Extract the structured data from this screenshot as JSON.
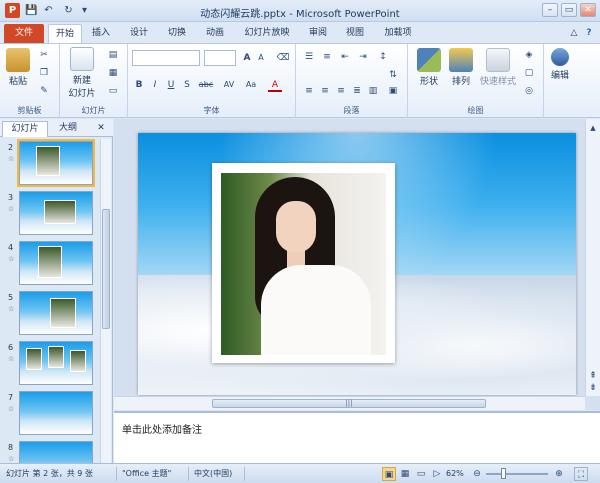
{
  "window": {
    "title": "动态闪耀云跳.pptx - Microsoft PowerPoint",
    "app_letter": "P",
    "qa_save": "💾",
    "qa_undo": "↶",
    "qa_redo": "↻",
    "qa_more": "▾",
    "btn_minimize": "–",
    "btn_restore": "▭",
    "btn_close": "✕"
  },
  "tabs": {
    "file": "文件",
    "home": "开始",
    "insert": "插入",
    "design": "设计",
    "transitions": "切换",
    "animations": "动画",
    "slideshow": "幻灯片放映",
    "review": "审阅",
    "view": "视图",
    "addins": "加载项",
    "collapse": "△",
    "help": "?"
  },
  "ribbon": {
    "clipboard": {
      "paste": "粘贴",
      "label": "剪贴板"
    },
    "slides": {
      "new_slide_line1": "新建",
      "new_slide_line2": "幻灯片",
      "label": "幻灯片"
    },
    "font": {
      "label": "字体",
      "bold": "B",
      "italic": "I",
      "underline": "U",
      "strike": "S",
      "shadow": "abc",
      "spacing": "AV",
      "case": "Aa",
      "grow": "A",
      "shrink": "A",
      "color": "A"
    },
    "paragraph": {
      "label": "段落"
    },
    "drawing": {
      "shapes": "形状",
      "arrange": "排列",
      "quickstyles": "快速样式",
      "label": "绘图"
    },
    "editing": {
      "label": "编辑"
    }
  },
  "left_panel": {
    "tab_slides": "幻灯片",
    "tab_outline": "大纲",
    "close": "✕",
    "slides": [
      {
        "num": "2",
        "star": "☆"
      },
      {
        "num": "3",
        "star": "☆"
      },
      {
        "num": "4",
        "star": "☆"
      },
      {
        "num": "5",
        "star": "☆"
      },
      {
        "num": "6",
        "star": "☆"
      },
      {
        "num": "7",
        "star": "☆"
      },
      {
        "num": "8",
        "star": "☆"
      }
    ]
  },
  "editor": {
    "hscroll_grip": "|||",
    "vscroll_up": "▲",
    "vscroll_prev": "⇞",
    "vscroll_next": "⇟"
  },
  "notes": {
    "placeholder": "单击此处添加备注"
  },
  "status": {
    "slide_info": "幻灯片 第 2 张，共 9 张",
    "theme": "\"Office 主题\"",
    "language": "中文(中国)",
    "zoom": "62%",
    "zoom_minus": "⊖",
    "zoom_plus": "⊕"
  },
  "colors": {
    "file_tab": "#d24726",
    "selected_slide_outline": "#f4b83c",
    "ribbon_bg": "#e5eef9"
  }
}
